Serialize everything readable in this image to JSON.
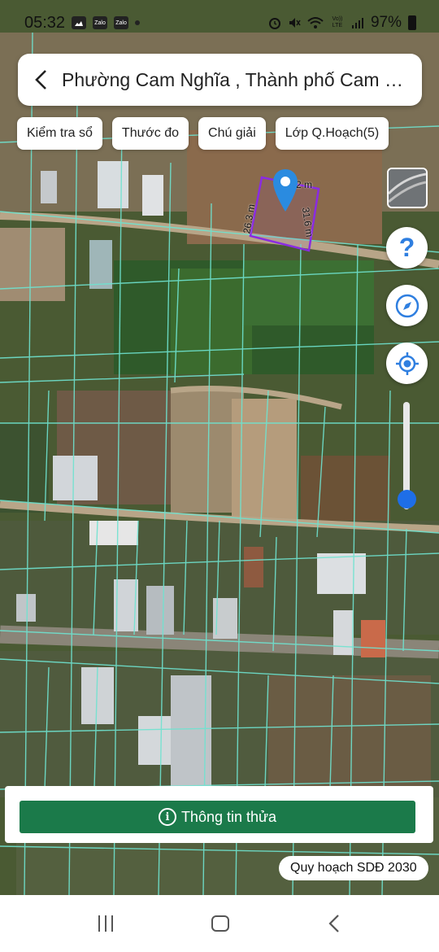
{
  "status_bar": {
    "time": "05:32",
    "icons": [
      "gallery-icon",
      "zalo-icon",
      "zalo-icon",
      "dot-icon"
    ],
    "zalo_label": "Zalo",
    "right_icons": [
      "alarm-icon",
      "mute-icon",
      "wifi-icon",
      "volte-icon",
      "signal-icon"
    ],
    "volte_label": "Vo)) LTE",
    "battery": "97%"
  },
  "header": {
    "title": "Phường Cam Nghĩa , Thành phố Cam Ra..."
  },
  "chips": [
    {
      "label": "Kiểm tra sổ"
    },
    {
      "label": "Thước đo"
    },
    {
      "label": "Chú giải"
    },
    {
      "label": "Lớp Q.Hoạch(5)"
    }
  ],
  "map": {
    "parcel": {
      "edge_top": "2 m",
      "edge_left": "26.3 m",
      "edge_right": "31.6 m"
    },
    "colors": {
      "parcel_border": "#8a2be2",
      "pin": "#2a8be0",
      "lot_lines": "#6fe3d0"
    }
  },
  "controls": {
    "help": "?",
    "slider_value": 0.9
  },
  "bottom": {
    "info_button": "Thông tin thửa",
    "info_icon_glyph": "i",
    "plan_badge": "Quy hoạch SDĐ 2030"
  }
}
